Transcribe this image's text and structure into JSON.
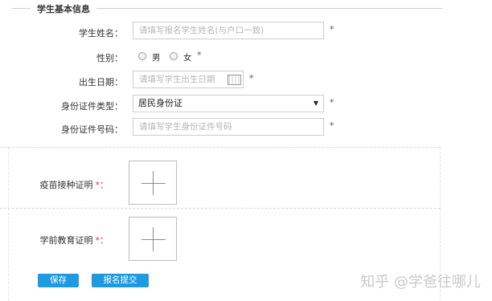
{
  "section": {
    "title": "学生基本信息"
  },
  "fields": {
    "name": {
      "label": "学生姓名：",
      "placeholder": "请填写报名学生姓名(与户口一致)",
      "required": "*"
    },
    "gender": {
      "label": "性别：",
      "options": [
        "男",
        "女"
      ],
      "required": "*"
    },
    "birth": {
      "label": "出生日期：",
      "placeholder": "请填写学生出生日期",
      "required": "*"
    },
    "id_type": {
      "label": "身份证件类型：",
      "value": "居民身份证",
      "arrow": "▼",
      "required": "*"
    },
    "id_number": {
      "label": "身份证件号码：",
      "placeholder": "请填写学生身份证件号码",
      "required": "*"
    }
  },
  "uploads": {
    "vaccine": {
      "label": "疫苗接种证明",
      "required": "*："
    },
    "preschool": {
      "label": "学前教育证明",
      "required": "*："
    }
  },
  "buttons": {
    "save": "保存",
    "submit": "报名提交"
  },
  "watermark": "知乎 @学爸往哪儿"
}
